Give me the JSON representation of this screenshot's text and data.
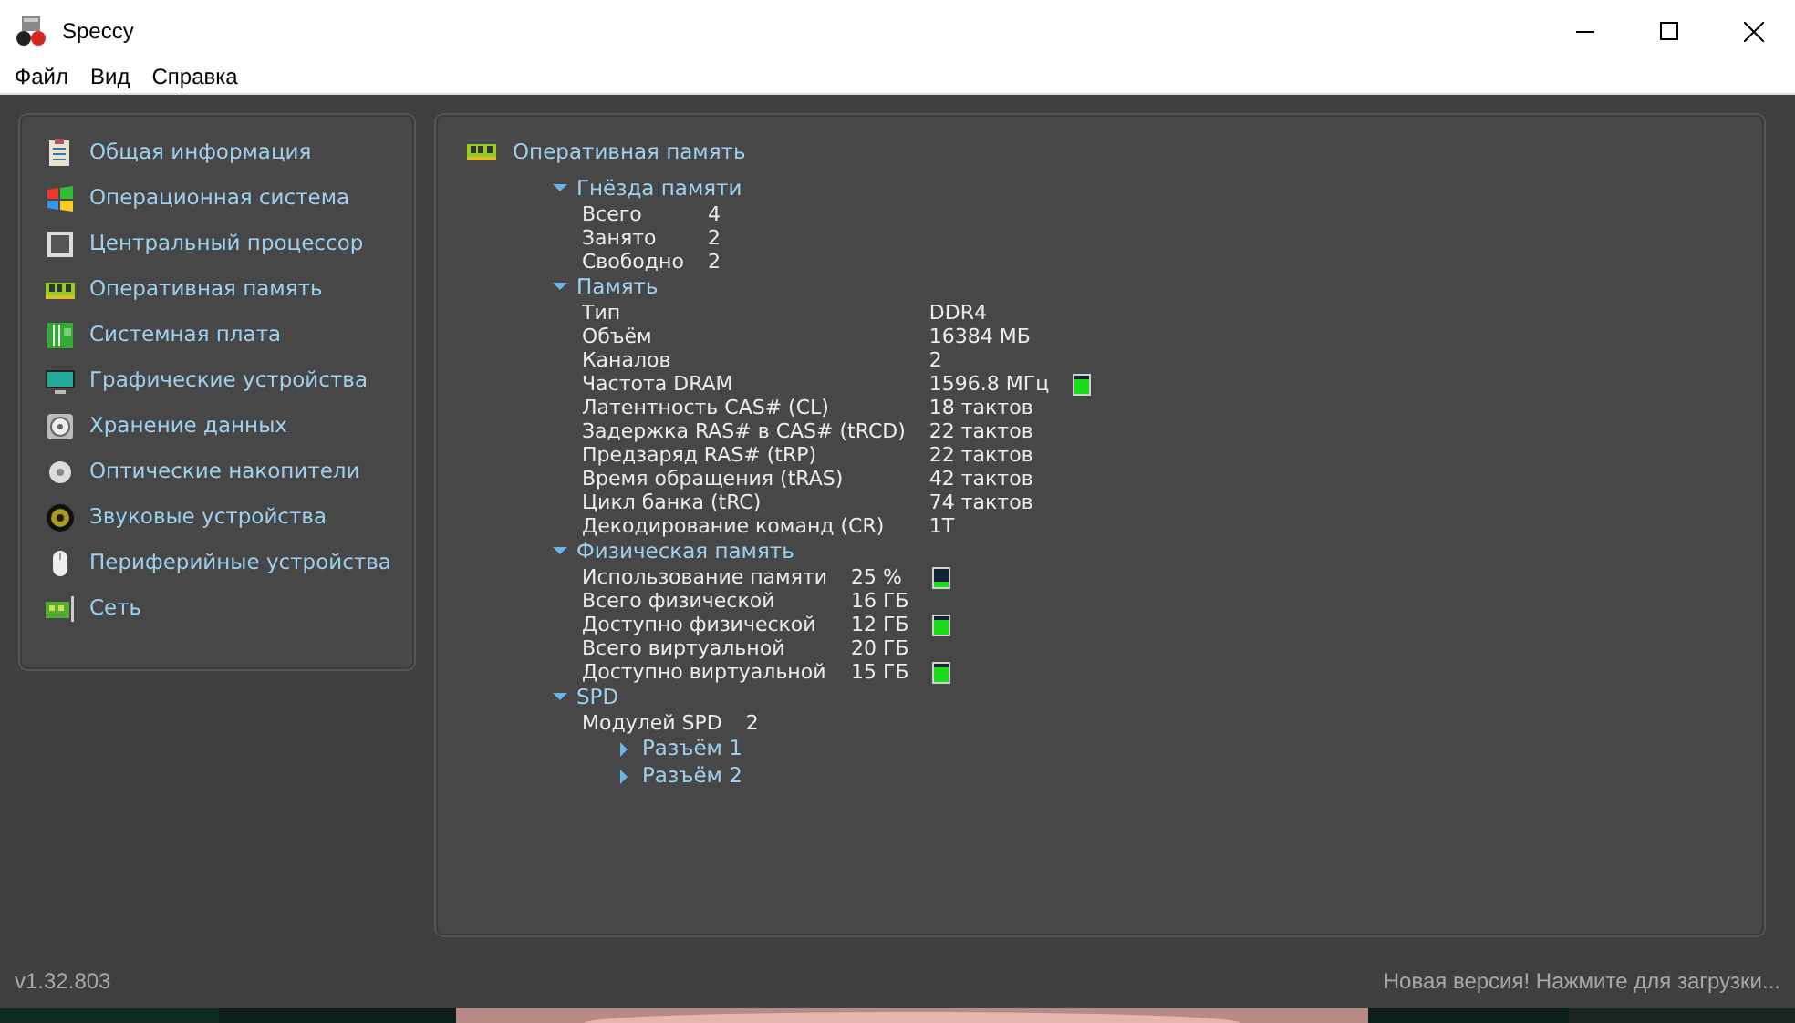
{
  "window": {
    "title": "Speccy"
  },
  "menu": [
    "Файл",
    "Вид",
    "Справка"
  ],
  "sidebar": {
    "items": [
      {
        "label": "Общая информация"
      },
      {
        "label": "Операционная система"
      },
      {
        "label": "Центральный процессор"
      },
      {
        "label": "Оперативная память"
      },
      {
        "label": "Системная плата"
      },
      {
        "label": "Графические устройства"
      },
      {
        "label": "Хранение данных"
      },
      {
        "label": "Оптические накопители"
      },
      {
        "label": "Звуковые устройства"
      },
      {
        "label": "Периферийные устройства"
      },
      {
        "label": "Сеть"
      }
    ]
  },
  "content": {
    "title": "Оперативная память",
    "groups": [
      {
        "title": "Гнёзда памяти",
        "expanded": true,
        "rows": [
          {
            "label": "Всего",
            "value": "4"
          },
          {
            "label": "Занято",
            "value": "2"
          },
          {
            "label": "Свободно",
            "value": "2"
          }
        ]
      },
      {
        "title": "Память",
        "expanded": true,
        "rows": [
          {
            "label": "Тип",
            "value": "DDR4"
          },
          {
            "label": "Объём",
            "value": "16384 МБ"
          },
          {
            "label": "Каналов",
            "value": "2"
          },
          {
            "label": "Частота DRAM",
            "value": "1596.8 МГц",
            "level": 0.8
          },
          {
            "label": "Латентность CAS# (CL)",
            "value": "18 тактов"
          },
          {
            "label": "Задержка RAS# в CAS# (tRCD)",
            "value": "22 тактов"
          },
          {
            "label": "Предзаряд RAS# (tRP)",
            "value": "22 тактов"
          },
          {
            "label": "Время обращения (tRAS)",
            "value": "42 тактов"
          },
          {
            "label": "Цикл банка (tRC)",
            "value": "74 тактов"
          },
          {
            "label": "Декодирование команд (CR)",
            "value": "1T"
          }
        ]
      },
      {
        "title": "Физическая память",
        "expanded": true,
        "rows": [
          {
            "label": "Использование памяти",
            "value": "25 %",
            "level": 0.25
          },
          {
            "label": "Всего физической",
            "value": "16 ГБ"
          },
          {
            "label": "Доступно физической",
            "value": "12 ГБ",
            "level": 0.75
          },
          {
            "label": "Всего виртуальной",
            "value": "20 ГБ"
          },
          {
            "label": "Доступно виртуальной",
            "value": "15 ГБ",
            "level": 0.75
          }
        ]
      },
      {
        "title": "SPD",
        "expanded": true,
        "rows": [
          {
            "label": "Модулей SPD",
            "value": "2"
          }
        ],
        "children": [
          {
            "title": "Разъём 1",
            "expanded": false
          },
          {
            "title": "Разъём 2",
            "expanded": false
          }
        ]
      }
    ]
  },
  "status_bar": {
    "version": "v1.32.803",
    "update": "Новая версия! Нажмите для загрузки..."
  }
}
